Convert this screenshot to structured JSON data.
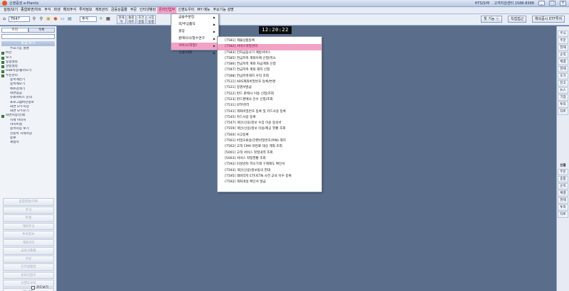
{
  "window": {
    "title": "신영증권 e-Plantic",
    "phone_label": "HTS/SI부",
    "phone": "고객지원센터 1588-8588"
  },
  "menu": [
    "설정/보기",
    "종합화면/차트",
    "주식",
    "파생",
    "해외주식",
    "투자정보",
    "계좌관리",
    "금융상품몰",
    "주문",
    "인터넷뱅킹",
    "온라인업무",
    "신영도우미",
    "MY 메뉴",
    "주요기능 설명"
  ],
  "active_menu": "온라인업무",
  "toolbar": {
    "code": "TR47",
    "stock_field": "주식",
    "buttons": [
      "현재가",
      "통합차트",
      "조건종합",
      "시장동향"
    ],
    "right_buttons": [
      "챗 기능 ⓒ",
      "직접접근",
      "해외증시 ETF투자"
    ]
  },
  "sidebar": {
    "tabs": [
      "트리",
      "목록"
    ],
    "header": "종합/보기",
    "items": [
      {
        "label": "주요기능 설명",
        "level": 1,
        "box": false
      },
      {
        "label": "버전",
        "level": 0,
        "box": true
      },
      {
        "label": "보기",
        "level": 0,
        "box": true
      },
      {
        "label": "종합설정",
        "level": 0,
        "box": true
      },
      {
        "label": "알람설정",
        "level": 0,
        "box": true
      },
      {
        "label": "USB저장/불러오기",
        "level": 0,
        "box": true
      },
      {
        "label": "주문관리",
        "level": 0,
        "box": true
      },
      {
        "label": "종목계산기",
        "level": 1,
        "box": false
      },
      {
        "label": "종목메모기",
        "level": 1,
        "box": false
      },
      {
        "label": "메뉴검색기",
        "level": 1,
        "box": false
      },
      {
        "label": "화면잠금",
        "level": 1,
        "box": false
      },
      {
        "label": "유료서비스 문의",
        "level": 1,
        "box": false
      },
      {
        "label": "프로그램버전정보",
        "level": 1,
        "box": false
      },
      {
        "label": "화면 모두저장",
        "level": 1,
        "box": false
      },
      {
        "label": "화면 모두닫기",
        "level": 1,
        "box": false
      },
      {
        "label": "화면저장/인쇄",
        "level": 0,
        "box": true
      },
      {
        "label": "시세 이미지",
        "level": 1,
        "box": false
      },
      {
        "label": "사이트맵",
        "level": 1,
        "box": false
      },
      {
        "label": "종목리칭 보기",
        "level": 1,
        "box": false
      },
      {
        "label": "전용목 시세저장",
        "level": 1,
        "box": false
      },
      {
        "label": "종료",
        "level": 1,
        "box": false
      },
      {
        "label": "재접속",
        "level": 1,
        "box": false
      }
    ],
    "section_buttons": [
      "종합화면/차트",
      "주식",
      "파생",
      "해외주식",
      "투자정보",
      "계좌관리",
      "금융상품몰",
      "주문",
      "인터넷뱅킹",
      "온라인업무",
      "신영도우미",
      "MY 메뉴",
      "주요기능 설명"
    ],
    "footer_label": "코드보기"
  },
  "rightbar": {
    "top": [
      "주식",
      "주문",
      "현재",
      "순익",
      "체결",
      "현재",
      "호가",
      "잔고",
      "뉴스",
      "기업",
      "투자",
      "차트"
    ],
    "bottom_head": "선물",
    "bottom": [
      "주문",
      "종합",
      "순익",
      "체결",
      "현재",
      "투자",
      "차트"
    ]
  },
  "clock": "12:20:22",
  "dropdown": {
    "items": [
      {
        "label": "금융주문업",
        "arrow": true
      },
      {
        "label": "외/주상품작",
        "arrow": true
      },
      {
        "label": "출장",
        "arrow": true
      },
      {
        "label": "판매의사/청수연구",
        "arrow": true
      },
      {
        "label": "서비스(약정)",
        "arrow": true,
        "selected": true
      },
      {
        "label": "신용/대출",
        "arrow": true
      }
    ]
  },
  "submenu": {
    "items": [
      "[7581] 계불상품등록",
      "[7582] 서비스약정관리",
      "[7583] 전자금융사기 예방서비스",
      "[7585] 연금저축 계좌이체 신청/취소",
      "[7586] 연금저축 계좌 자금계좌 신청",
      "[7587] 연금저축 계좌 해지 신청",
      "[7588] 연금저축해지 수익 조회",
      "[7511] ARS계좌비밀번호 등록/변경",
      "[7521] 증명서발급",
      "[7522] 펀드 판매사 이동 신청/조회",
      "[7523] 펀드판매사 인수 신청/조회",
      "[7531] OTP관리",
      "[7541] 계좌비밀번호 등록 및 카드사용 등록",
      "[7545] 카드사용 등록",
      "[7547] 개인(신용)정보 수집 이용 동의서",
      "[7559] 개인(신용)정보 이용/제공 현황 조회",
      "[7560] 사고등록",
      "[7561] 비밀오류송/간편비밀번호(PIN) 해지",
      "[7562] 고객 CMA 마련료 대상 계좌 조회",
      "[5001] 고객 서비스 약정내역 조회",
      "[5003] 서비스 약정현황 조회",
      "[7592] 미성년자 학오기래 구제제도 확인서",
      "[7593] 개인(신용)정보동의 현대",
      "[7595] 레버리지 ETF/ETN 사전 교육 이수 등록",
      "[7592] 계좌개설 확인서 발급"
    ],
    "selected_index": 1
  }
}
